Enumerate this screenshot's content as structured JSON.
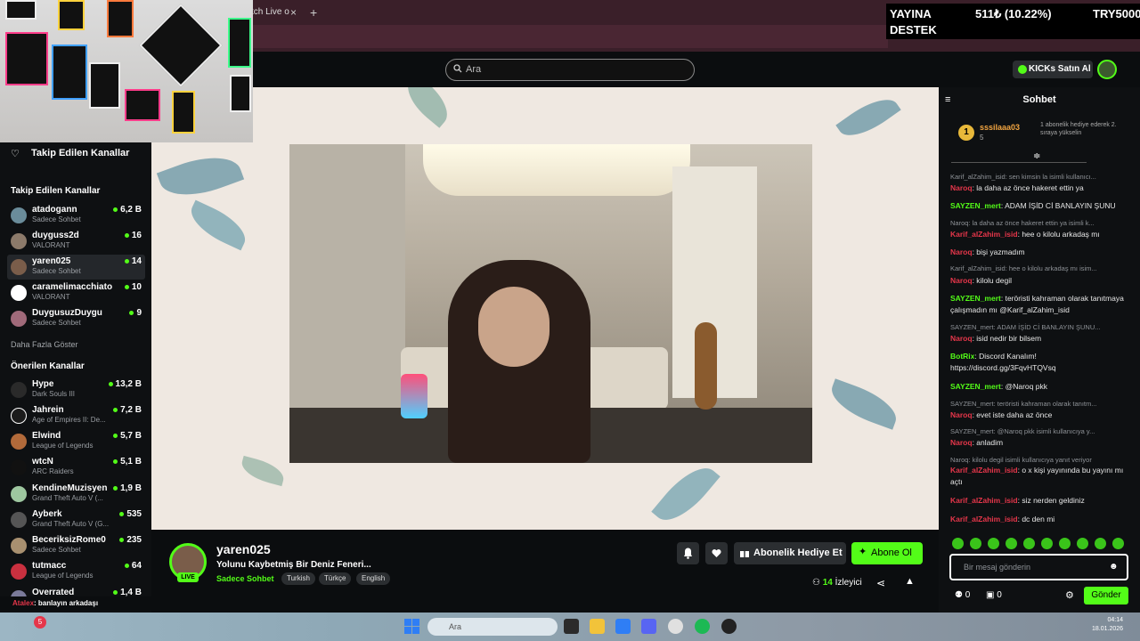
{
  "browser": {
    "tab_label": "tch Live o",
    "tab_close": "×",
    "tab_new": "+"
  },
  "overlay": {
    "line1": "YAYINA",
    "line2": "DESTEK",
    "value": "511₺ (10.22%)",
    "goal": "TRY5000"
  },
  "header": {
    "search_placeholder": "Ara",
    "kicks_button": "KICKs Satın Al"
  },
  "sidebar": {
    "header": "Takip Edilen Kanallar",
    "followed_title": "Takip Edilen Kanallar",
    "followed": [
      {
        "name": "atadogann",
        "category": "Sadece Sohbet",
        "viewers": "6,2 B"
      },
      {
        "name": "duyguss2d",
        "category": "VALORANT",
        "viewers": "16"
      },
      {
        "name": "yaren025",
        "category": "Sadece Sohbet",
        "viewers": "14"
      },
      {
        "name": "caramelimacchiato",
        "category": "VALORANT",
        "viewers": "10"
      },
      {
        "name": "DuygusuzDuygu",
        "category": "Sadece Sohbet",
        "viewers": "9"
      }
    ],
    "show_more": "Daha Fazla Göster",
    "recommended_title": "Önerilen Kanallar",
    "recommended": [
      {
        "name": "Hype",
        "category": "Dark Souls III",
        "viewers": "13,2 B"
      },
      {
        "name": "Jahrein",
        "category": "Age of Empires II: De...",
        "viewers": "7,2 B"
      },
      {
        "name": "Elwind",
        "category": "League of Legends",
        "viewers": "5,7 B"
      },
      {
        "name": "wtcN",
        "category": "ARC Raiders",
        "viewers": "5,1 B"
      },
      {
        "name": "KendineMuzisyen",
        "category": "Grand Theft Auto V (...",
        "viewers": "1,9 B"
      },
      {
        "name": "Ayberk",
        "category": "Grand Theft Auto V (G...",
        "viewers": "535"
      },
      {
        "name": "BeceriksizRome0",
        "category": "Sadece Sohbet",
        "viewers": "235"
      },
      {
        "name": "tutmacc",
        "category": "League of Legends",
        "viewers": "64"
      },
      {
        "name": "Overrated",
        "category": "",
        "viewers": "1,4 B"
      }
    ]
  },
  "stream": {
    "streamer": "yaren025",
    "live": "LIVE",
    "title": "Yolunu Kaybetmiş Bir Deniz Feneri...",
    "category": "Sadece Sohbet",
    "tags": [
      "Turkish",
      "Türkçe",
      "English"
    ],
    "gift_button": "Abonelik Hediye Et",
    "subscribe_button": "Abone Ol",
    "viewer_count": "14",
    "viewer_label": "İzleyici"
  },
  "chat": {
    "title": "Sohbet",
    "pinned": {
      "rank": "1",
      "user": "sssilaaa03",
      "count": "5",
      "note": "1 abonelik hediye ederek 2. sıraya yükselin"
    },
    "messages": [
      {
        "type": "reply",
        "text": "Karif_alZahim_isid: sen kimsin la isimli kullanıcı..."
      },
      {
        "type": "msg",
        "user": "Naroq",
        "color": "red",
        "text": ": la daha az önce hakeret ettin ya"
      },
      {
        "type": "msg",
        "user": "SAYZEN_mert",
        "color": "green",
        "text": ": ADAM İŞİD Cİ BANLAYIN ŞUNU"
      },
      {
        "type": "reply",
        "text": "Naroq: la daha az önce hakeret ettin ya isimli k..."
      },
      {
        "type": "msg",
        "user": "Karif_alZahim_isid",
        "color": "red",
        "text": ": hee o kilolu arkadaş mı"
      },
      {
        "type": "msg",
        "user": "Naroq",
        "color": "red",
        "text": ": bişi yazmadım"
      },
      {
        "type": "reply",
        "text": "Karif_alZahim_isid: hee o kilolu arkadaş mı isim..."
      },
      {
        "type": "msg",
        "user": "Naroq",
        "color": "red",
        "text": ": kilolu degil"
      },
      {
        "type": "msg",
        "user": "SAYZEN_mert",
        "color": "green",
        "text": ": teröristi kahraman olarak tanıtmaya çalışmadın mı @Karif_alZahim_isid"
      },
      {
        "type": "reply",
        "text": "SAYZEN_mert: ADAM İŞİD Cİ BANLAYIN ŞUNU..."
      },
      {
        "type": "msg",
        "user": "Naroq",
        "color": "red",
        "text": ": isid nedir bir bilsem"
      },
      {
        "type": "msg",
        "user": "BotRix",
        "color": "green",
        "text": ": Discord Kanalım! https://discord.gg/3FqvHTQVsq"
      },
      {
        "type": "msg",
        "user": "SAYZEN_mert",
        "color": "green",
        "text": ": @Naroq pkk"
      },
      {
        "type": "reply",
        "text": "SAYZEN_mert: teröristi kahraman olarak tanıtm..."
      },
      {
        "type": "msg",
        "user": "Naroq",
        "color": "red",
        "text": ": evet iste daha az önce"
      },
      {
        "type": "reply",
        "text": "SAYZEN_mert: @Naroq pkk isimli kullanıcıya y..."
      },
      {
        "type": "msg",
        "user": "Naroq",
        "color": "red",
        "text": ": anladim"
      },
      {
        "type": "reply",
        "text": "Naroq: kilolu degil isimli kullanıcıya yanıt veriyor"
      },
      {
        "type": "msg",
        "user": "Karif_alZahim_isid",
        "color": "red",
        "text": ": o x kişi yayınında bu yayını mı açtı"
      },
      {
        "type": "msg",
        "user": "Karif_alZahim_isid",
        "color": "red",
        "text": ": siz nerden geldiniz"
      },
      {
        "type": "msg",
        "user": "Karif_alZahim_isid",
        "color": "red",
        "text": ": dc den mi"
      }
    ],
    "input_placeholder": "Bir mesaj gönderin",
    "kicks_count": "0",
    "gift_count": "0",
    "send_button": "Gönder"
  },
  "bottom_strip": {
    "user": "Atalex",
    "text": ": banlayın arkadaşı"
  },
  "taskbar": {
    "search_placeholder": "Ara",
    "time": "04:14",
    "date": "18.01.2026",
    "notif": "5"
  },
  "colors": {
    "accent": "#53fc18",
    "username_red": "#e5364a",
    "background": "#0b0d0f"
  }
}
